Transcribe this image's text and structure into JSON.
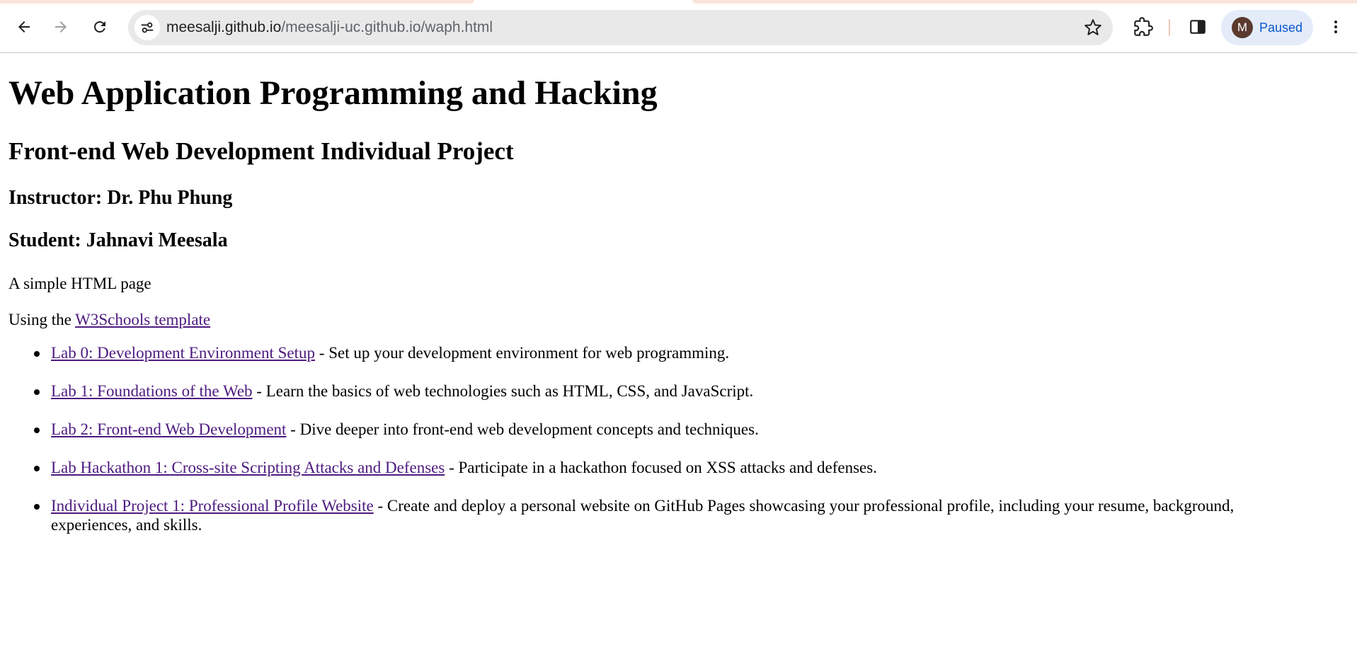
{
  "browser": {
    "url_host": "meesalji.github.io",
    "url_path": "/meesalji-uc.github.io/waph.html",
    "profile_initial": "M",
    "profile_status": "Paused",
    "icons": [
      "back-arrow-icon",
      "forward-arrow-icon",
      "reload-icon",
      "site-info-icon",
      "star-icon",
      "extensions-icon",
      "side-panel-icon",
      "more-vert-icon"
    ]
  },
  "page": {
    "title": "Web Application Programming and Hacking",
    "subtitle": "Front-end Web Development Individual Project",
    "instructor": "Instructor: Dr. Phu Phung",
    "student": "Student: Jahnavi Meesala",
    "intro": "A simple HTML page",
    "template_prefix": "Using the ",
    "template_link": "W3Schools template",
    "labs": [
      {
        "link": "Lab 0: Development Environment Setup",
        "desc": " - Set up your development environment for web programming."
      },
      {
        "link": "Lab 1: Foundations of the Web",
        "desc": " - Learn the basics of web technologies such as HTML, CSS, and JavaScript."
      },
      {
        "link": "Lab 2: Front-end Web Development",
        "desc": " - Dive deeper into front-end web development concepts and techniques."
      },
      {
        "link": "Lab Hackathon 1: Cross-site Scripting Attacks and Defenses",
        "desc": " - Participate in a hackathon focused on XSS attacks and defenses."
      },
      {
        "link": "Individual Project 1: Professional Profile Website",
        "desc": " - Create and deploy a personal website on GitHub Pages showcasing your professional profile, including your resume, background, experiences, and skills."
      }
    ]
  },
  "colors": {
    "link_visited": "#4d1a7f",
    "omnibox_bg": "#e9e9e9",
    "profile_bg": "#e3ecf8",
    "profile_text": "#0b57d0",
    "tab_strip": "#fbe3da"
  }
}
